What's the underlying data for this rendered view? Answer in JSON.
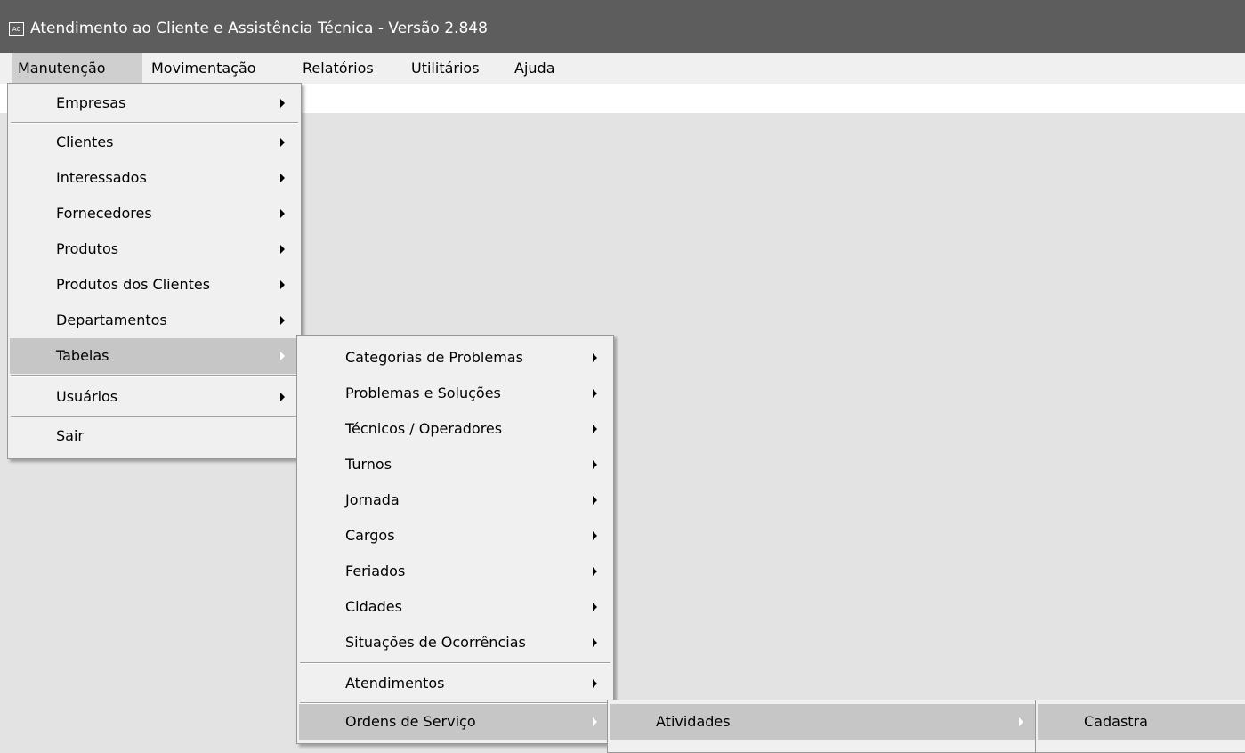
{
  "window": {
    "icon_text": "AC",
    "title": "Atendimento ao Cliente e Assistência Técnica - Versão 2.848"
  },
  "menubar": {
    "items": [
      "Manutenção",
      "Movimentação",
      "Relatórios",
      "Utilitários",
      "Ajuda"
    ]
  },
  "menu_manutencao": {
    "items": [
      "Empresas",
      "Clientes",
      "Interessados",
      "Fornecedores",
      "Produtos",
      "Produtos dos Clientes",
      "Departamentos",
      "Tabelas",
      "Usuários",
      "Sair"
    ]
  },
  "menu_tabelas": {
    "items": [
      "Categorias de Problemas",
      "Problemas e Soluções",
      "Técnicos / Operadores",
      "Turnos",
      "Jornada",
      "Cargos",
      "Feriados",
      "Cidades",
      "Situações de Ocorrências",
      "Atendimentos",
      "Ordens de Serviço"
    ]
  },
  "menu_ordens": {
    "items": [
      "Atividades"
    ]
  },
  "menu_atividades": {
    "items": [
      "Cadastra"
    ]
  }
}
